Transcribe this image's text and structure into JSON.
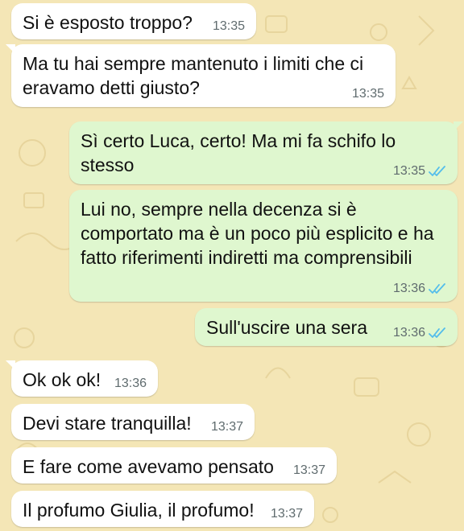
{
  "colors": {
    "wallpaper": "#f4e6b6",
    "incoming_bubble": "#ffffff",
    "outgoing_bubble": "#dff7cf",
    "read_ticks": "#53bdeb",
    "timestamp": "#5f6b6e"
  },
  "messages": [
    {
      "direction": "incoming",
      "text": "Si è esposto troppo?",
      "time": "13:35"
    },
    {
      "direction": "incoming",
      "text": "Ma tu hai sempre mantenuto i limiti che ci eravamo detti giusto?",
      "time": "13:35"
    },
    {
      "direction": "outgoing",
      "text": "Sì certo Luca, certo! Ma mi fa schifo lo stesso",
      "time": "13:35",
      "status_icon": "double-check-read-icon"
    },
    {
      "direction": "outgoing",
      "text": "Lui no, sempre nella decenza si è comportato ma è un poco più esplicito e ha fatto riferimenti indiretti ma comprensibili",
      "time": "13:36",
      "status_icon": "double-check-read-icon"
    },
    {
      "direction": "outgoing",
      "text": "Sull'uscire una sera",
      "time": "13:36",
      "status_icon": "double-check-read-icon"
    },
    {
      "direction": "incoming",
      "text": "Ok ok ok!",
      "time": "13:36"
    },
    {
      "direction": "incoming",
      "text": "Devi stare tranquilla!",
      "time": "13:37"
    },
    {
      "direction": "incoming",
      "text": "E fare come avevamo pensato",
      "time": "13:37"
    },
    {
      "direction": "incoming",
      "text": "Il profumo Giulia, il profumo!",
      "time": "13:37"
    }
  ]
}
